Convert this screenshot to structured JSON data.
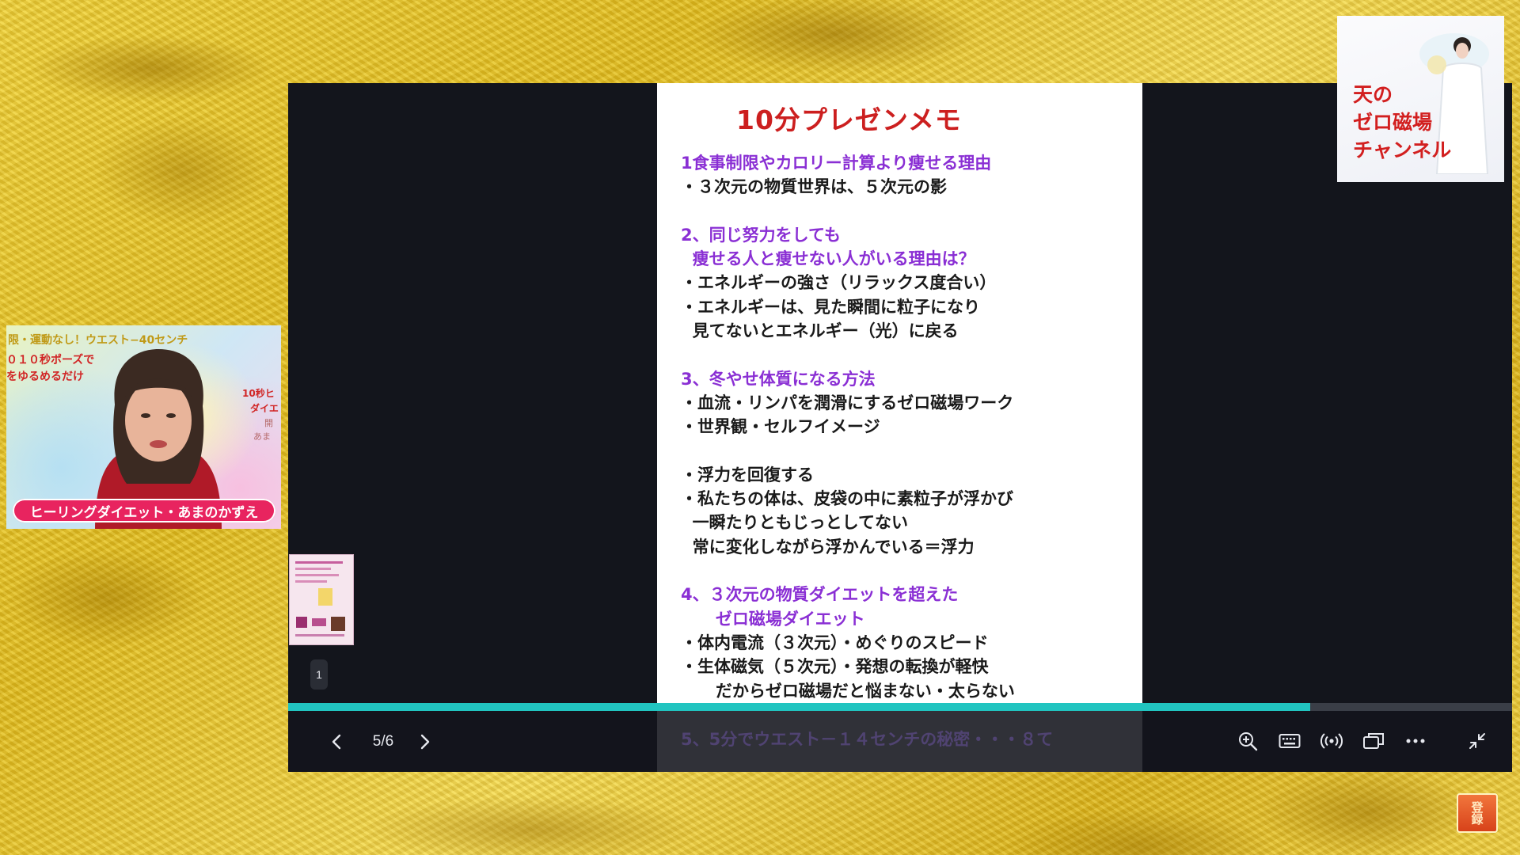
{
  "slide": {
    "title": "10分プレゼンメモ",
    "lines": [
      {
        "t": "1食事制限やカロリー計算より痩せる理由",
        "k": "h"
      },
      {
        "t": "・３次元の物質世界は、５次元の影",
        "k": "b"
      },
      {
        "t": "",
        "k": "b"
      },
      {
        "t": "2、同じ努力をしても",
        "k": "h"
      },
      {
        "t": "  痩せる人と痩せない人がいる理由は？",
        "k": "h"
      },
      {
        "t": "・エネルギーの強さ（リラックス度合い）",
        "k": "b"
      },
      {
        "t": "・エネルギーは、見た瞬間に粒子になり",
        "k": "b"
      },
      {
        "t": "  見てないとエネルギー（光）に戻る",
        "k": "b"
      },
      {
        "t": "",
        "k": "b"
      },
      {
        "t": "3、冬やせ体質になる方法",
        "k": "h"
      },
      {
        "t": "・血流・リンパを潤滑にするゼロ磁場ワーク",
        "k": "b"
      },
      {
        "t": "・世界観・セルフイメージ",
        "k": "b"
      },
      {
        "t": "",
        "k": "b"
      },
      {
        "t": "・浮力を回復する",
        "k": "b"
      },
      {
        "t": "・私たちの体は、皮袋の中に素粒子が浮かび",
        "k": "b"
      },
      {
        "t": "  一瞬たりともじっとしてない",
        "k": "b"
      },
      {
        "t": "  常に変化しながら浮かんでいる＝浮力",
        "k": "b"
      },
      {
        "t": "",
        "k": "b"
      },
      {
        "t": "4、３次元の物質ダイエットを超えた",
        "k": "h"
      },
      {
        "t": "      ゼロ磁場ダイエット",
        "k": "h"
      },
      {
        "t": "・体内電流（３次元）・めぐりのスピード",
        "k": "b"
      },
      {
        "t": "・生体磁気（５次元）・発想の転換が軽快",
        "k": "b"
      },
      {
        "t": "      だからゼロ磁場だと悩まない・太らない",
        "k": "b"
      }
    ],
    "overlay_line": "5、5分でウエスト－１４センチの秘密・・・８て"
  },
  "player": {
    "page_counter": "5/6",
    "progress": 0.835,
    "accent_color": "#21c4c0",
    "thumb_number": "1",
    "icons": [
      "chevron-left-icon",
      "chevron-right-icon",
      "zoom-in-icon",
      "keyboard-icon",
      "broadcast-icon",
      "picture-in-picture-icon",
      "more-icon",
      "collapse-icon"
    ]
  },
  "webcam": {
    "top_caption": "限・運動なし！ウエスト−40センチ",
    "left_line1": "０１０秒ポーズで",
    "left_line2": "をゆるめるだけ",
    "right_line1": "10秒ヒ",
    "right_line2": "ダイエ",
    "right_line3": "開",
    "right_line4": "あま",
    "name_tag": "ヒーリングダイエット・あまのかずえ"
  },
  "channel": {
    "line1": "天の",
    "line2": "ゼロ磁場",
    "line3": "チャンネル"
  },
  "subscribe": {
    "label": "登録"
  }
}
